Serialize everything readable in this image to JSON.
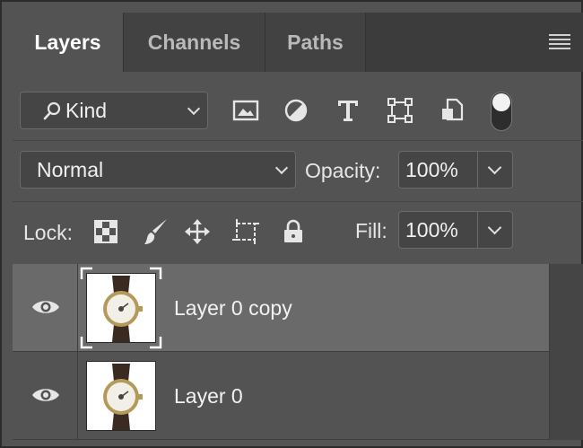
{
  "tabs": [
    {
      "label": "Layers",
      "active": true
    },
    {
      "label": "Channels",
      "active": false
    },
    {
      "label": "Paths",
      "active": false
    }
  ],
  "filter": {
    "kind_label": "Kind",
    "icons": [
      "image-filter-icon",
      "adjustment-filter-icon",
      "type-filter-icon",
      "shape-filter-icon",
      "smart-object-filter-icon"
    ],
    "toggle_on": true
  },
  "blend": {
    "mode": "Normal",
    "opacity_label": "Opacity:",
    "opacity_value": "100%"
  },
  "lock": {
    "label": "Lock:",
    "icons": [
      "lock-transparent-pixels-icon",
      "lock-image-pixels-icon",
      "lock-position-icon",
      "lock-artboard-icon",
      "lock-all-icon"
    ],
    "fill_label": "Fill:",
    "fill_value": "100%"
  },
  "layers": [
    {
      "name": "Layer 0 copy",
      "selected": true,
      "visible": true
    },
    {
      "name": "Layer 0",
      "selected": false,
      "visible": true
    }
  ],
  "colors": {
    "panel_bg": "#535353",
    "selected_row": "#6a6a6a",
    "text": "#e6e6e6"
  }
}
